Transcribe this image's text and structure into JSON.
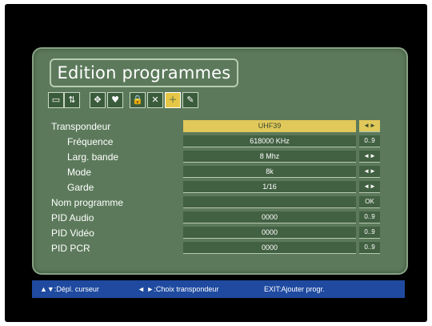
{
  "title": "Edition programmes",
  "iconbar": {
    "icons": [
      "tv-icon",
      "sort-icon",
      "move-icon",
      "favorite-icon",
      "lock-icon",
      "delete-icon",
      "add-icon",
      "edit-icon"
    ],
    "glyphs": [
      "▭",
      "⇅",
      "✥",
      "♥",
      "🔒",
      "✕",
      "＋",
      "✎"
    ],
    "selected_color": "#e6c646"
  },
  "rows": [
    {
      "label": "Transpondeur",
      "value": "UHF39",
      "control": "◄►",
      "indent": false,
      "highlight": true
    },
    {
      "label": "Fréquence",
      "value": "618000 KHz",
      "control": "0..9",
      "indent": true,
      "highlight": false
    },
    {
      "label": "Larg. bande",
      "value": "8 Mhz",
      "control": "◄►",
      "indent": true,
      "highlight": false
    },
    {
      "label": "Mode",
      "value": "8k",
      "control": "◄►",
      "indent": true,
      "highlight": false
    },
    {
      "label": "Garde",
      "value": "1/16",
      "control": "◄►",
      "indent": true,
      "highlight": false
    },
    {
      "label": "Nom programme",
      "value": "",
      "control": "OK",
      "indent": false,
      "highlight": false
    },
    {
      "label": "PID Audio",
      "value": "0000",
      "control": "0..9",
      "indent": false,
      "highlight": false
    },
    {
      "label": "PID Vidéo",
      "value": "0000",
      "control": "0..9",
      "indent": false,
      "highlight": false
    },
    {
      "label": "PID PCR",
      "value": "0000",
      "control": "0..9",
      "indent": false,
      "highlight": false
    }
  ],
  "footer": {
    "hint1": "▲▼:Dépl. curseur",
    "hint2": "◄ ►:Choix transpondeur",
    "hint3": "EXIT:Ajouter progr."
  },
  "colors": {
    "panel": "#5c7a5b",
    "highlight": "#e0c85a",
    "footer": "#1f4aa0"
  }
}
